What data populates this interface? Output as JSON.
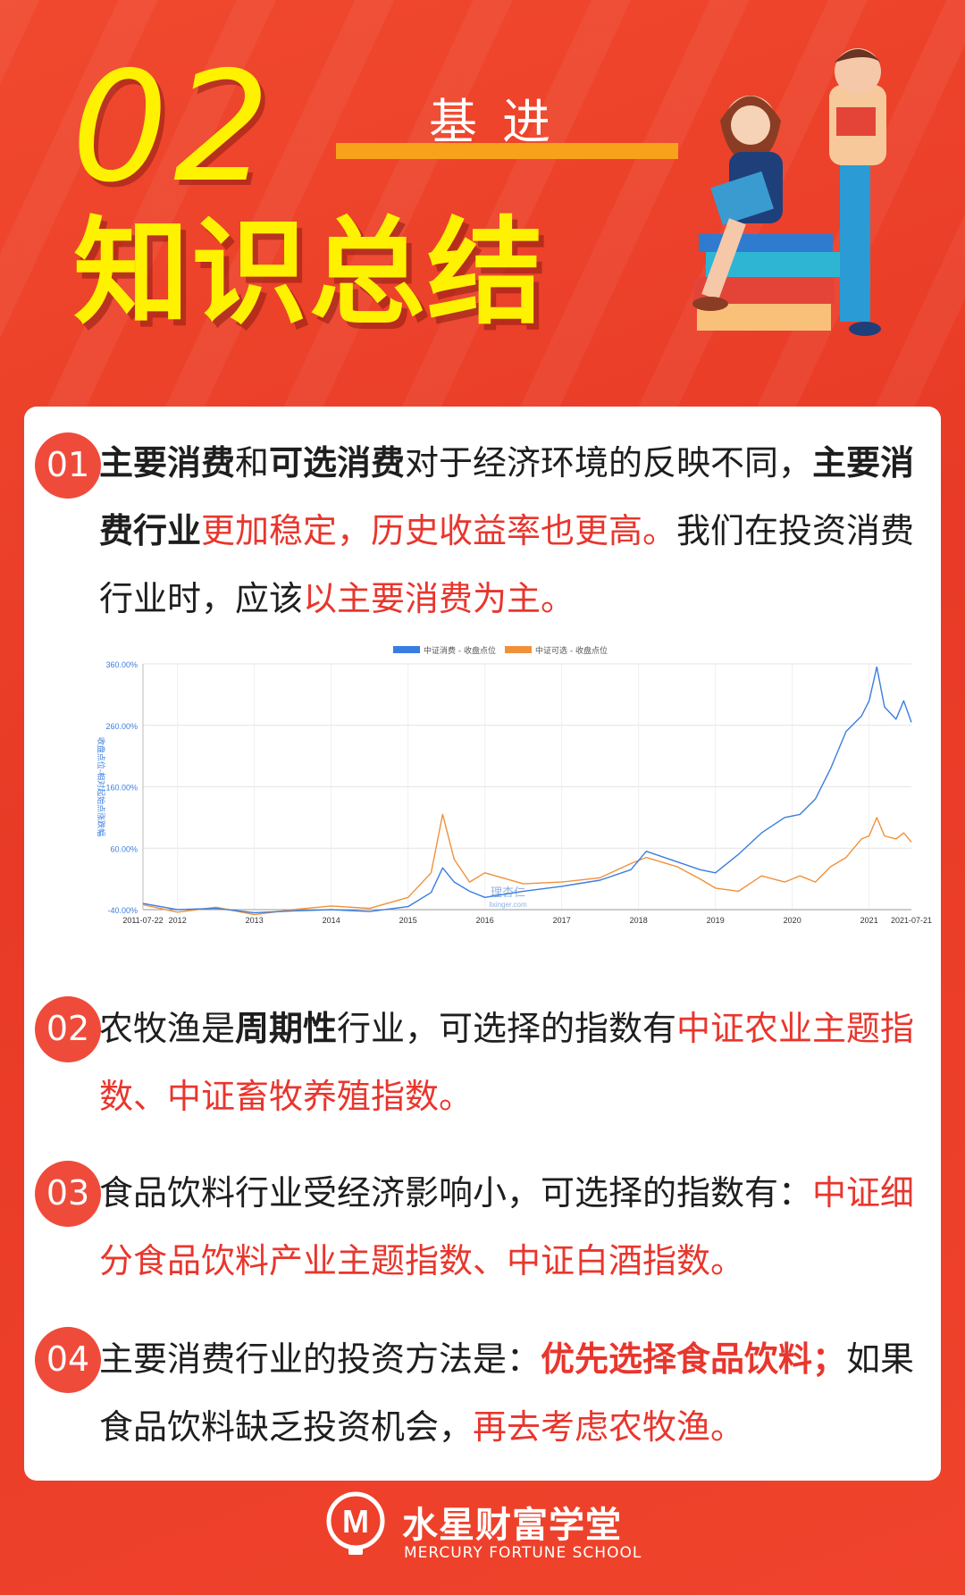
{
  "header": {
    "number": "02",
    "subtitle": "基进",
    "title": "知识总结"
  },
  "items": [
    {
      "badge": "01",
      "segments": [
        {
          "t": "主要消费",
          "s": "b"
        },
        {
          "t": "和",
          "s": ""
        },
        {
          "t": "可选消费",
          "s": "b"
        },
        {
          "t": "对于经济环境的反映不同，",
          "s": ""
        },
        {
          "t": "主要消费行业",
          "s": "b"
        },
        {
          "t": "更加稳定，历史收益率也更高。",
          "s": "r"
        },
        {
          "t": "我们在投资消费行业时，应该",
          "s": ""
        },
        {
          "t": "以主要消费为主。",
          "s": "r"
        }
      ]
    },
    {
      "badge": "02",
      "segments": [
        {
          "t": "农牧渔是",
          "s": ""
        },
        {
          "t": "周期性",
          "s": "b"
        },
        {
          "t": "行业，可选择的指数有",
          "s": ""
        },
        {
          "t": "中证农业主题指数、中证畜牧养殖指数。",
          "s": "r"
        }
      ]
    },
    {
      "badge": "03",
      "segments": [
        {
          "t": "食品饮料行业受经济影响小，可选择的指数有：",
          "s": ""
        },
        {
          "t": "中证细分食品饮料产业主题指数、中证白酒指数。",
          "s": "r"
        }
      ]
    },
    {
      "badge": "04",
      "segments": [
        {
          "t": "主要消费行业的投资方法是：",
          "s": ""
        },
        {
          "t": "优先选择食品饮料；",
          "s": "rb"
        },
        {
          "t": "如果食品饮料缺乏投资机会，",
          "s": ""
        },
        {
          "t": "再去考虑农牧渔。",
          "s": "r"
        }
      ]
    }
  ],
  "chart_data": {
    "type": "line",
    "ylabel": "收盘点位-相对起始点涨跌幅",
    "y_ticks": [
      "360.00%",
      "260.00%",
      "160.00%",
      "60.00%",
      "-40.00%"
    ],
    "ylim": [
      -40,
      360
    ],
    "x_ticks": [
      "2011-07-22",
      "2012",
      "2013",
      "2014",
      "2015",
      "2016",
      "2017",
      "2018",
      "2019",
      "2020",
      "2021",
      "2021-07-21"
    ],
    "watermark": "理杏仁",
    "watermark_url": "lixinger.com",
    "colors": {
      "consumer": "#3a7de0",
      "optional": "#f0913a"
    },
    "series": [
      {
        "name": "中证消费 - 收盘点位",
        "x": [
          2011.55,
          2012.0,
          2012.5,
          2013.0,
          2013.5,
          2014.0,
          2014.5,
          2015.0,
          2015.3,
          2015.45,
          2015.6,
          2015.8,
          2016.0,
          2016.5,
          2017.0,
          2017.5,
          2017.9,
          2018.1,
          2018.5,
          2018.8,
          2019.0,
          2019.3,
          2019.6,
          2019.9,
          2020.1,
          2020.3,
          2020.5,
          2020.7,
          2020.9,
          2021.0,
          2021.1,
          2021.2,
          2021.35,
          2021.45,
          2021.55
        ],
        "y": [
          -30,
          -40,
          -38,
          -45,
          -42,
          -40,
          -43,
          -35,
          -12,
          28,
          5,
          -10,
          -20,
          -10,
          -2,
          8,
          25,
          55,
          38,
          25,
          20,
          50,
          85,
          110,
          115,
          140,
          190,
          250,
          275,
          300,
          355,
          290,
          270,
          300,
          265
        ]
      },
      {
        "name": "中证可选 - 收盘点位",
        "x": [
          2011.55,
          2012.0,
          2012.5,
          2013.0,
          2013.5,
          2014.0,
          2014.5,
          2015.0,
          2015.3,
          2015.45,
          2015.6,
          2015.8,
          2016.0,
          2016.5,
          2017.0,
          2017.5,
          2017.9,
          2018.1,
          2018.5,
          2018.8,
          2019.0,
          2019.3,
          2019.6,
          2019.9,
          2020.1,
          2020.3,
          2020.5,
          2020.7,
          2020.9,
          2021.0,
          2021.1,
          2021.2,
          2021.35,
          2021.45,
          2021.55
        ],
        "y": [
          -32,
          -44,
          -36,
          -48,
          -40,
          -34,
          -38,
          -20,
          20,
          115,
          42,
          5,
          20,
          2,
          5,
          12,
          35,
          45,
          30,
          10,
          -5,
          -10,
          15,
          5,
          15,
          5,
          30,
          45,
          75,
          80,
          110,
          80,
          75,
          85,
          70
        ]
      }
    ]
  },
  "footer": {
    "logo_letter": "M",
    "brand_cn": "水星财富学堂",
    "brand_en": "MERCURY FORTUNE SCHOOL"
  }
}
